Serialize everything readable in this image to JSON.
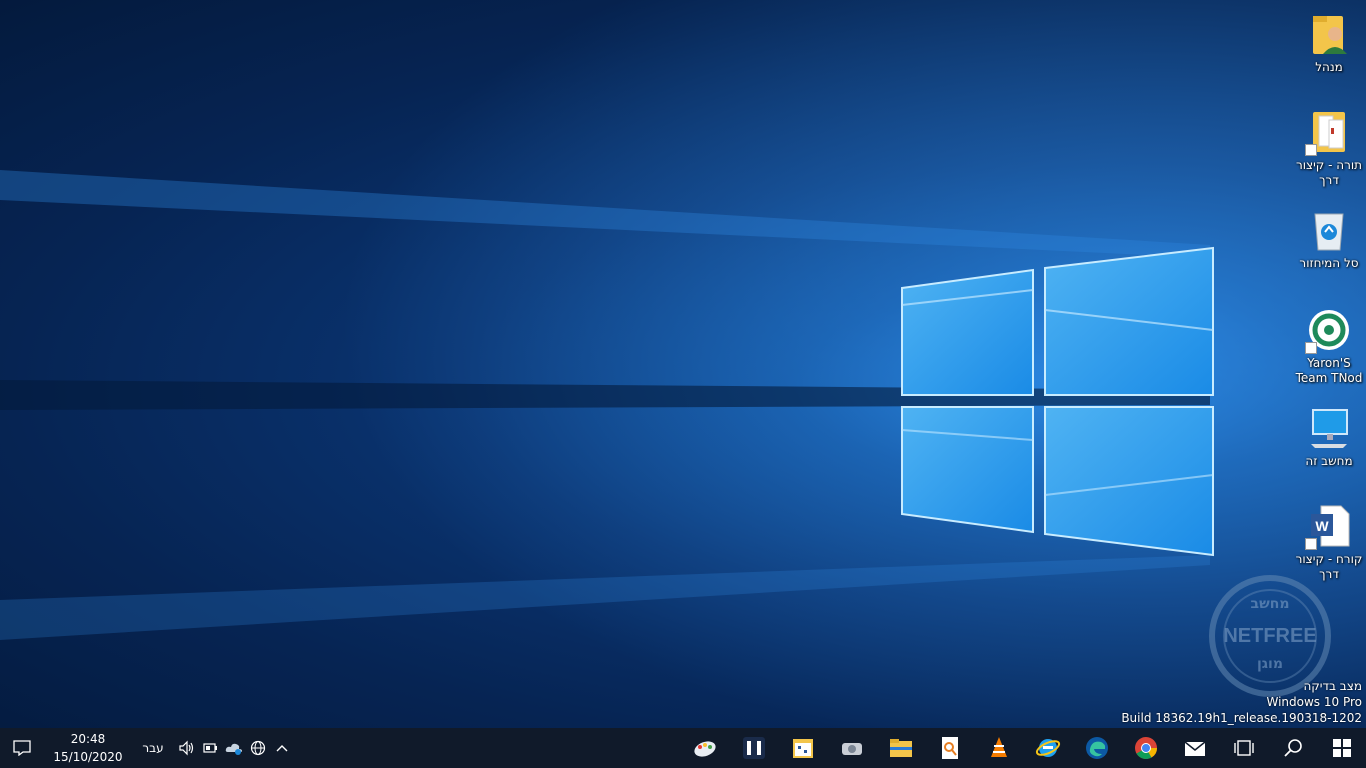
{
  "desktop": {
    "icons": [
      {
        "label": "מנהל",
        "icon": "user-folder-icon"
      },
      {
        "label": "תורה - קיצור דרך",
        "icon": "folder-shortcut-icon"
      },
      {
        "label": "סל המיחזור",
        "icon": "recycle-bin-icon"
      },
      {
        "label": "Yaron'S Team TNod",
        "icon": "tnod-icon"
      },
      {
        "label": "מחשב זה",
        "icon": "this-pc-icon"
      },
      {
        "label": "קורח - קיצור דרך",
        "icon": "word-document-icon"
      }
    ]
  },
  "watermark": {
    "top_text": "מחשב",
    "middle_text": "NETFREE",
    "bottom_text": "מוגן"
  },
  "build_info": {
    "mode": "מצב בדיקה",
    "edition": "Windows 10 Pro",
    "build": "Build 18362.19h1_release.190318-1202"
  },
  "taskbar": {
    "clock_time": "20:48",
    "clock_date": "15/10/2020",
    "language": "עבר",
    "tray_icons": [
      "volume-icon",
      "battery-icon",
      "onedrive-icon",
      "network-icon",
      "chevron-up-icon"
    ],
    "apps": [
      "windows-start-icon",
      "search-icon",
      "task-view-icon",
      "mail-icon",
      "chrome-icon",
      "edge-icon",
      "internet-explorer-icon",
      "vlc-icon",
      "document-search-icon",
      "file-explorer-icon",
      "scanner-app-icon",
      "calendar-app-icon",
      "tools-app-icon",
      "paint-app-icon"
    ]
  },
  "colors": {
    "taskbar": "#101a2a",
    "accent": "#0a6fd6"
  }
}
